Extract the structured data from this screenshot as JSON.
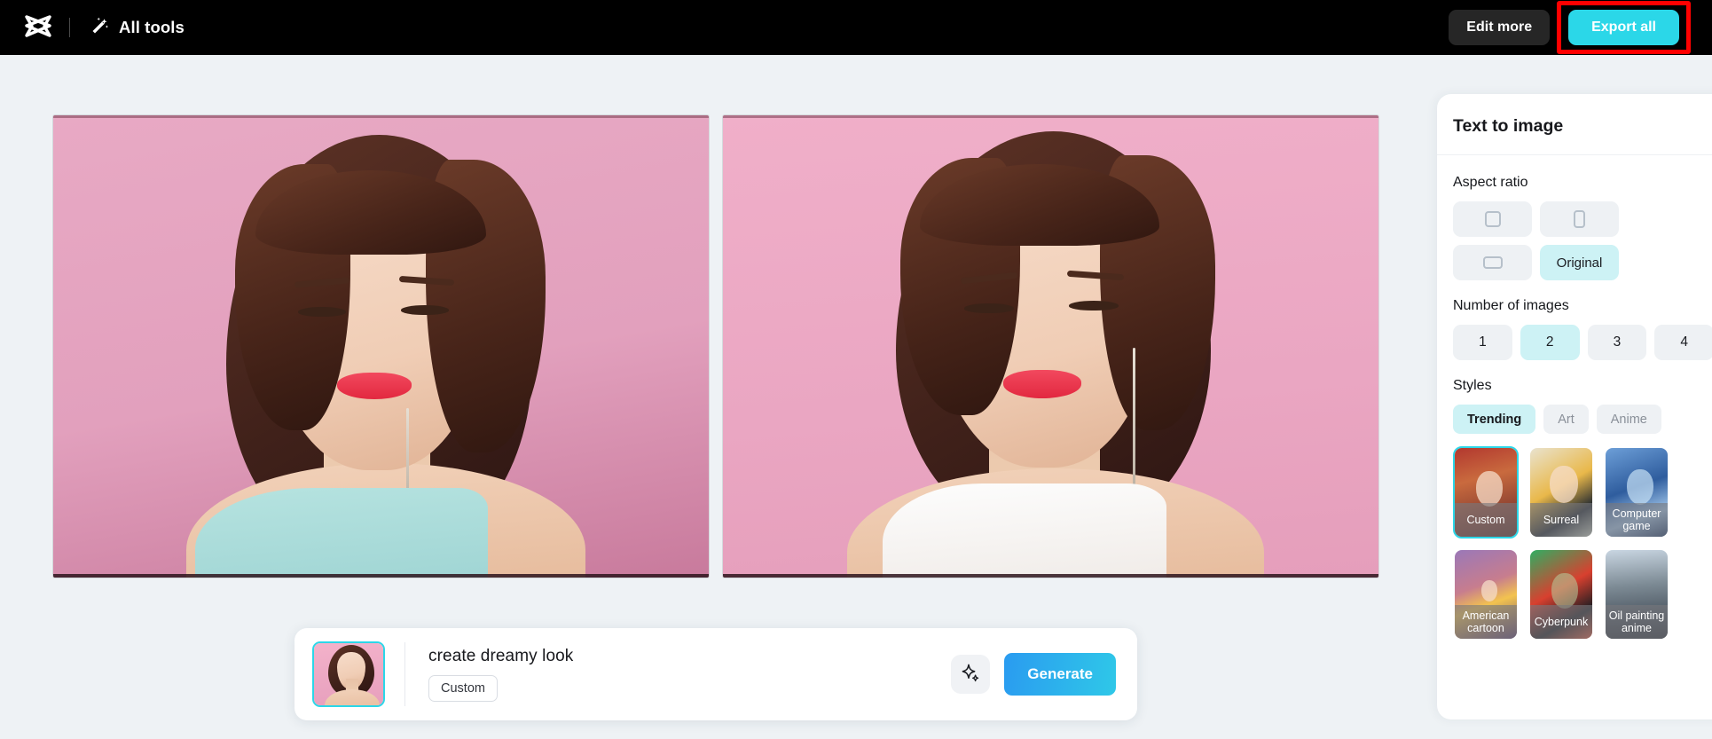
{
  "topbar": {
    "logo_icon": "capcut-logo-icon",
    "wand_icon": "magic-wand-icon",
    "all_tools_label": "All tools",
    "edit_more_label": "Edit more",
    "export_all_label": "Export all",
    "export_highlight_color": "#ff0000",
    "export_button_color": "#2bd7e8",
    "background_color": "#000000"
  },
  "canvas": {
    "background_color": "#eef2f5",
    "images": [
      {
        "name": "generated-image-1",
        "alt": "Portrait of a woman with dark wavy hair on a pink background wearing a light blue top"
      },
      {
        "name": "generated-image-2",
        "alt": "Portrait of a woman with dark wavy hair on a pink background wearing a white top and a long earring"
      }
    ]
  },
  "prompt_bar": {
    "thumbnail_alt": "Reference photo of a woman on a pink background",
    "prompt_text": "create dreamy look",
    "style_chip_label": "Custom",
    "magic_icon": "sparkle-icon",
    "generate_label": "Generate"
  },
  "panel": {
    "title": "Text to image",
    "aspect_ratio": {
      "label": "Aspect ratio",
      "options": [
        {
          "label": "",
          "icon": "square-ratio-icon",
          "selected": false
        },
        {
          "label": "",
          "icon": "portrait-ratio-icon",
          "selected": false
        },
        {
          "label": "",
          "icon": "landscape-ratio-icon",
          "selected": false
        },
        {
          "label": "Original",
          "icon": "",
          "selected": true
        }
      ]
    },
    "number_of_images": {
      "label": "Number of images",
      "options": [
        "1",
        "2",
        "3",
        "4"
      ],
      "selected": "2"
    },
    "styles": {
      "label": "Styles",
      "tabs": [
        {
          "label": "Trending",
          "selected": true
        },
        {
          "label": "Art",
          "selected": false
        },
        {
          "label": "Anime",
          "selected": false
        }
      ],
      "items": [
        {
          "label": "Custom",
          "selected": true,
          "art": "art-custom"
        },
        {
          "label": "Surreal",
          "selected": false,
          "art": "art-surreal"
        },
        {
          "label": "Computer game",
          "selected": false,
          "art": "art-cgame"
        },
        {
          "label": "American cartoon",
          "selected": false,
          "art": "art-amcart"
        },
        {
          "label": "Cyberpunk",
          "selected": false,
          "art": "art-cyber"
        },
        {
          "label": "Oil painting anime",
          "selected": false,
          "art": "art-oil"
        }
      ]
    },
    "selected_color": "#cdf2f5",
    "accent_color": "#2bd7e8"
  }
}
